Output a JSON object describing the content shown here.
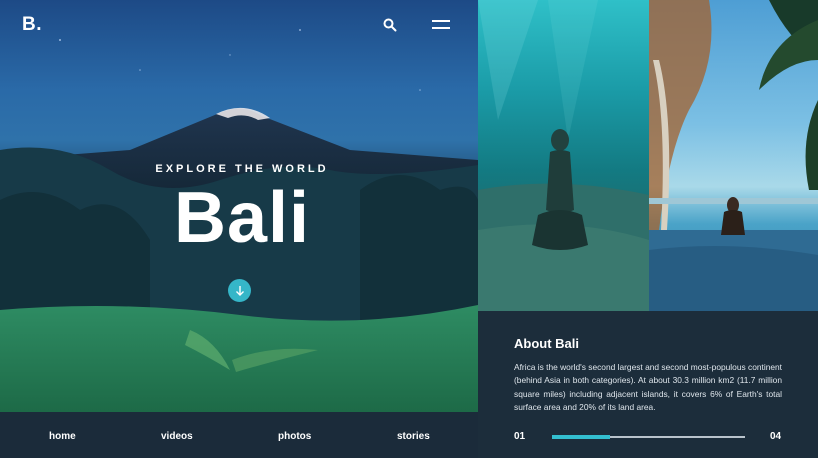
{
  "brand": {
    "logo": "B."
  },
  "header": {
    "search_icon": "search-icon",
    "menu_icon": "hamburger-menu-icon"
  },
  "hero": {
    "eyebrow": "EXPLORE THE WORLD",
    "title": "Bali",
    "scroll_icon": "arrow-down-icon"
  },
  "nav": {
    "items": [
      "home",
      "videos",
      "photos",
      "stories"
    ]
  },
  "about": {
    "title": "About Bali",
    "body": "Africa is the world's second largest and second most-populous continent (behind Asia in both categories). At about 30.3 million km2 (11.7 million square miles) including adjacent islands, it covers 6% of Earth's total surface area and 20% of its land area."
  },
  "slider": {
    "current": "01",
    "total": "04",
    "progress": 0.3
  },
  "colors": {
    "accent": "#33bfd0",
    "background": "#1b2b3a",
    "panel": "#1c2d3b"
  }
}
